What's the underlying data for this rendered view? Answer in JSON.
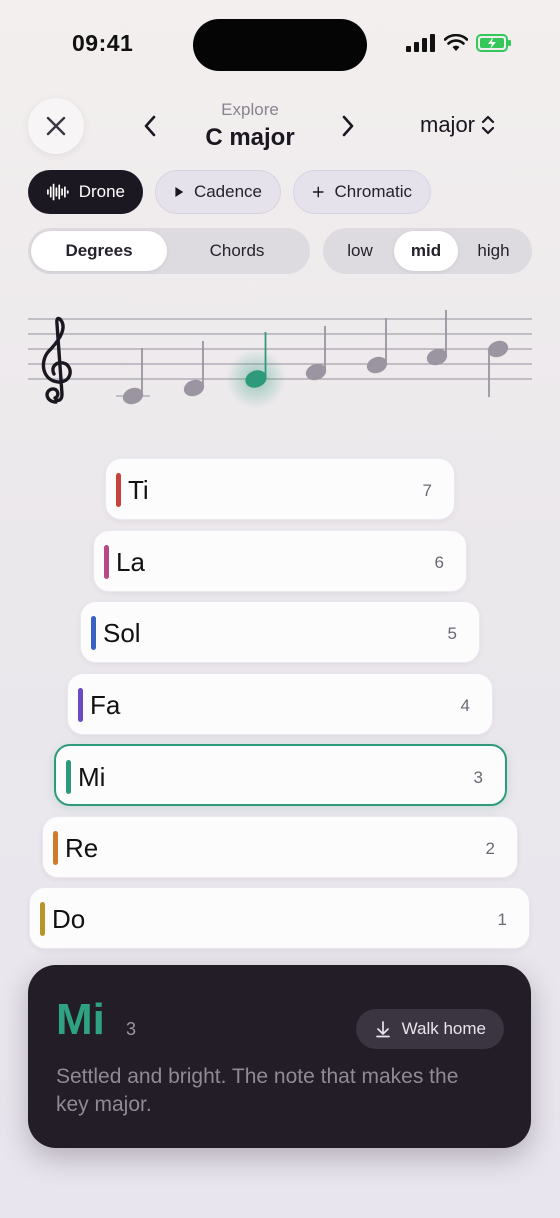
{
  "status_bar": {
    "time": "09:41"
  },
  "header": {
    "subtitle": "Explore",
    "title": "C major",
    "mode": "major"
  },
  "chips": {
    "drone": "Drone",
    "cadence": "Cadence",
    "chromatic": "Chromatic"
  },
  "view_segment": {
    "options": [
      "Degrees",
      "Chords"
    ],
    "selected": "Degrees"
  },
  "register_segment": {
    "options": [
      "low",
      "mid",
      "high"
    ],
    "selected": "mid"
  },
  "staff": {
    "active_note_color": "#2f9a7b",
    "note_color": "#9a95a0"
  },
  "degrees": [
    {
      "name": "Ti",
      "number": "7",
      "color": "#c8423b"
    },
    {
      "name": "La",
      "number": "6",
      "color": "#b84785"
    },
    {
      "name": "Sol",
      "number": "5",
      "color": "#3a62c2"
    },
    {
      "name": "Fa",
      "number": "4",
      "color": "#6a4bc4"
    },
    {
      "name": "Mi",
      "number": "3",
      "color": "#2f9a7b",
      "active": true
    },
    {
      "name": "Re",
      "number": "2",
      "color": "#d07a2c"
    },
    {
      "name": "Do",
      "number": "1",
      "color": "#b8952a"
    }
  ],
  "detail": {
    "name": "Mi",
    "number": "3",
    "action": "Walk home",
    "description": "Settled and bright. The note that makes the key major."
  },
  "icons": {
    "close": "close-icon",
    "prev": "chevron-left-icon",
    "next": "chevron-right-icon",
    "mode": "chevron-up-down-icon",
    "drone": "waveform-icon",
    "cadence": "play-icon",
    "chromatic": "plus-icon",
    "walk": "arrow-down-icon",
    "clef": "treble-clef-icon"
  },
  "colors": {
    "accent": "#2f9a7b",
    "card_bg": "#221d27"
  }
}
